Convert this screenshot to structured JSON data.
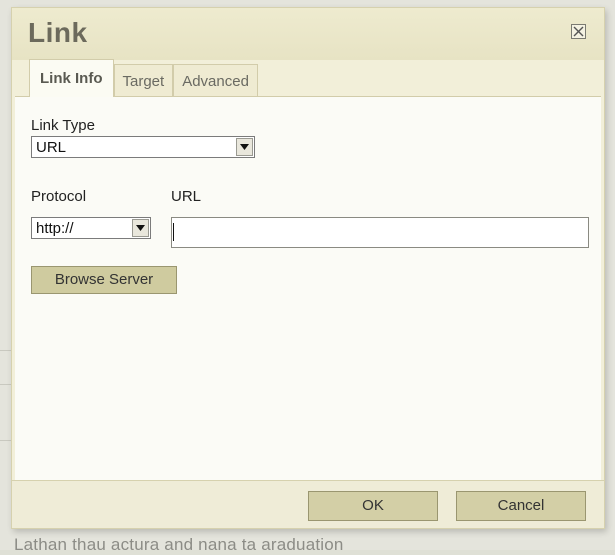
{
  "dialog": {
    "title": "Link",
    "close_icon": "close-icon",
    "tabs": [
      {
        "label": "Link Info",
        "active": true
      },
      {
        "label": "Target",
        "active": false
      },
      {
        "label": "Advanced",
        "active": false
      }
    ]
  },
  "link_info": {
    "link_type_label": "Link Type",
    "link_type_value": "URL",
    "protocol_label": "Protocol",
    "protocol_value": "http://",
    "url_label": "URL",
    "url_value": "",
    "browse_server_label": "Browse Server"
  },
  "footer": {
    "ok_label": "OK",
    "cancel_label": "Cancel"
  },
  "background": {
    "text": "Lathan thau actura and nana ta araduation"
  },
  "colors": {
    "dialog_bg": "#f2efd9",
    "panel_bg": "#fbfbf6",
    "button_bg": "#d3cfa6",
    "title_text": "#6c6a5c"
  }
}
